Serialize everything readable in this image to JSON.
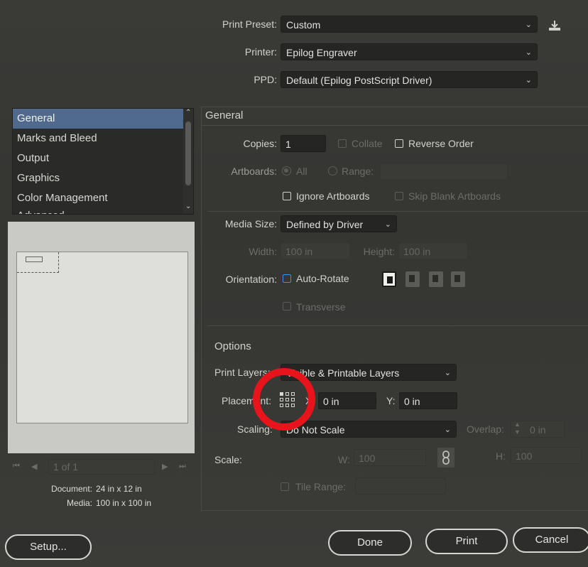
{
  "header": {
    "print_preset_label": "Print Preset:",
    "print_preset_value": "Custom",
    "printer_label": "Printer:",
    "printer_value": "Epilog Engraver",
    "ppd_label": "PPD:",
    "ppd_value": "Default (Epilog PostScript Driver)"
  },
  "sidebar": {
    "items": [
      {
        "label": "General"
      },
      {
        "label": "Marks and Bleed"
      },
      {
        "label": "Output"
      },
      {
        "label": "Graphics"
      },
      {
        "label": "Color Management"
      },
      {
        "label": "Advanced"
      }
    ],
    "selected_index": 0
  },
  "preview": {
    "page_indicator": "1 of 1",
    "document_label": "Document:",
    "document_value": "24 in x 12 in",
    "media_label": "Media:",
    "media_value": "100 in x 100 in"
  },
  "general": {
    "section_title": "General",
    "copies_label": "Copies:",
    "copies_value": "1",
    "collate_label": "Collate",
    "reverse_order_label": "Reverse Order",
    "artboards_label": "Artboards:",
    "all_label": "All",
    "range_label": "Range:",
    "ignore_artboards_label": "Ignore Artboards",
    "skip_blank_label": "Skip Blank Artboards",
    "media_size_label": "Media Size:",
    "media_size_value": "Defined by Driver",
    "width_label": "Width:",
    "width_value": "100 in",
    "height_label": "Height:",
    "height_value": "100 in",
    "orientation_label": "Orientation:",
    "auto_rotate_label": "Auto-Rotate",
    "transverse_label": "Transverse"
  },
  "options": {
    "section_title": "Options",
    "print_layers_label": "Print Layers:",
    "print_layers_value": "Visible & Printable Layers",
    "placement_label": "Placement:",
    "x_label": "X:",
    "x_value": "0 in",
    "y_label": "Y:",
    "y_value": "0 in",
    "scaling_label": "Scaling:",
    "scaling_value": "Do Not Scale",
    "overlap_label": "Overlap:",
    "overlap_value": "0 in",
    "scale_label": "Scale:",
    "w_label": "W:",
    "w_value": "100",
    "h_label": "H:",
    "h_value": "100",
    "tile_range_label": "Tile Range:"
  },
  "buttons": {
    "setup": "Setup...",
    "done": "Done",
    "print": "Print",
    "cancel": "Cancel"
  },
  "colors": {
    "highlight_ring": "#e8141c",
    "selection_blue": "#506a8e",
    "checkbox_blue": "#3e8ee6"
  }
}
